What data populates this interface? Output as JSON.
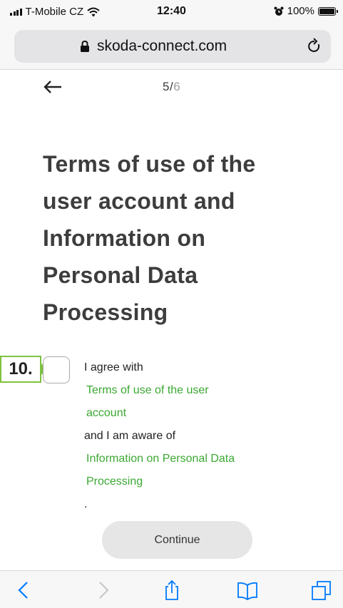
{
  "status_bar": {
    "carrier": "T-Mobile CZ",
    "time": "12:40",
    "battery_percent": "100%",
    "battery_level": 1.0
  },
  "browser": {
    "url": "skoda-connect.com"
  },
  "progress": {
    "current": "5",
    "separator": "/",
    "total": "6"
  },
  "page": {
    "title_lines": [
      "Terms of use of the",
      "user account and",
      "Information on",
      "Personal Data",
      "Processing"
    ],
    "annotation_label": "10.",
    "checkbox_checked": false,
    "consent": {
      "line1": "I agree with",
      "link1_line1": "Terms of use of the user",
      "link1_line2": "account",
      "line2": "and I am aware of",
      "link2_line1": "Information on Personal Data",
      "link2_line2": "Processing",
      "trailing": "."
    },
    "continue_label": "Continue"
  },
  "colors": {
    "link_green": "#3ba832",
    "annotation_green": "#7ec240",
    "ios_blue": "#007aff",
    "title_gray": "#3d3d3d"
  },
  "toolbar_icons": [
    "back-icon",
    "forward-icon",
    "share-icon",
    "bookmarks-icon",
    "tabs-icon"
  ]
}
